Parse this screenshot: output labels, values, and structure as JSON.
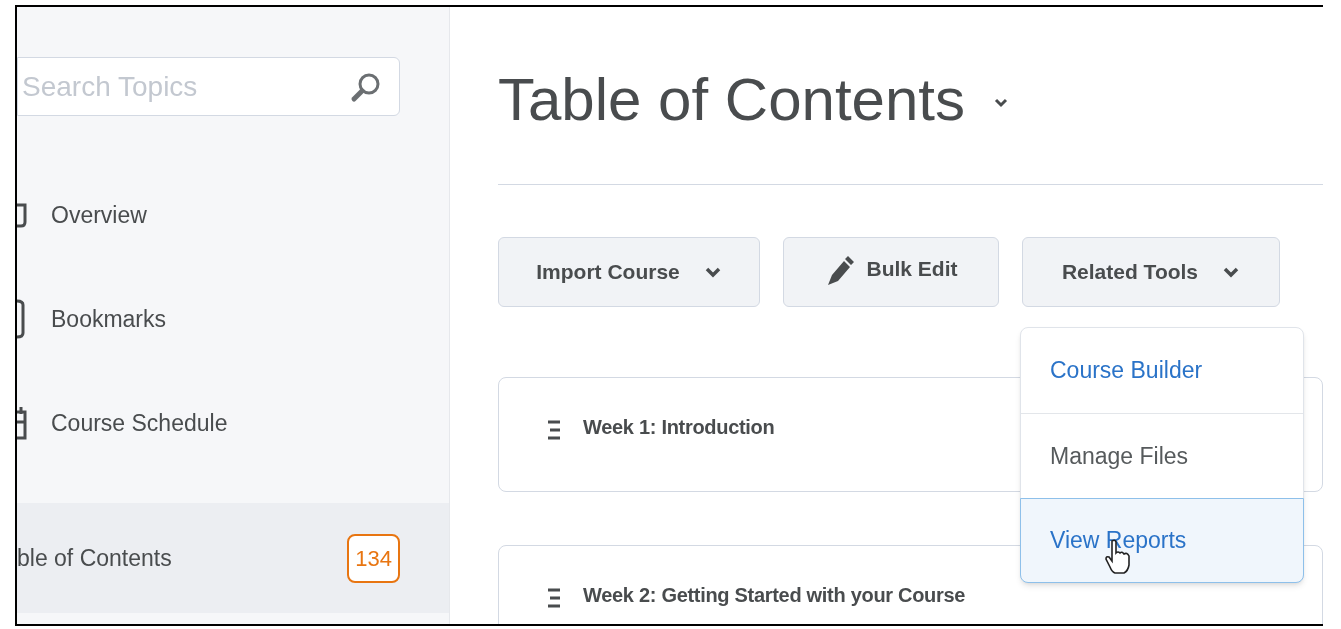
{
  "sidebar": {
    "search": {
      "placeholder": "Search Topics"
    },
    "items": [
      {
        "label": "Overview",
        "kind": "overview",
        "selected": false
      },
      {
        "label": "Bookmarks",
        "kind": "bookmark",
        "selected": false
      },
      {
        "label": "Course Schedule",
        "kind": "calendar",
        "selected": false
      },
      {
        "label": "ble of Contents",
        "selected": true,
        "badge": "134"
      }
    ]
  },
  "main": {
    "title": "Table of Contents",
    "toolbar": [
      {
        "label": "Import Course",
        "kind": "dropdown"
      },
      {
        "label": "Bulk Edit",
        "kind": "icon"
      },
      {
        "label": "Related Tools",
        "kind": "dropdown"
      }
    ],
    "menu": {
      "items": [
        {
          "label": "Course Builder",
          "color": "#2a73c8",
          "selected": false
        },
        {
          "label": "Manage Files",
          "color": "#565a5c",
          "selected": false
        },
        {
          "label": "View Reports",
          "color": "#2a73c8",
          "selected": true
        }
      ]
    },
    "modules": [
      {
        "title": "Week 1: Introduction"
      },
      {
        "title": "Week 2: Getting Started with your Course"
      }
    ]
  }
}
